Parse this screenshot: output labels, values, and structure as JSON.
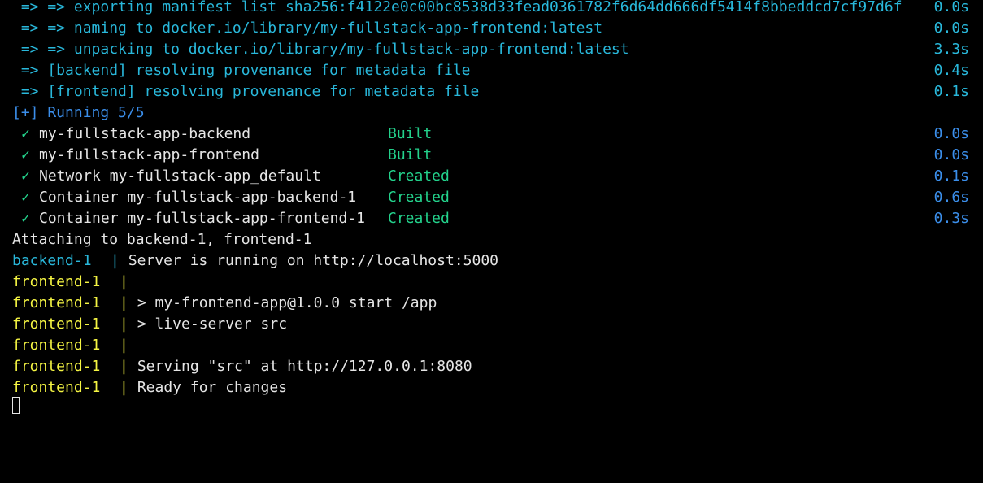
{
  "build_steps": [
    {
      "text": " => => exporting manifest list sha256:f4122e0c00bc8538d33fead0361782f6d64dd666df5414f8bbeddcd7cf97d6f",
      "duration": "0.0s"
    },
    {
      "text": " => => naming to docker.io/library/my-fullstack-app-frontend:latest",
      "duration": "0.0s"
    },
    {
      "text": " => => unpacking to docker.io/library/my-fullstack-app-frontend:latest",
      "duration": "3.3s"
    },
    {
      "text": " => [backend] resolving provenance for metadata file",
      "duration": "0.4s"
    },
    {
      "text": " => [frontend] resolving provenance for metadata file",
      "duration": "0.1s"
    }
  ],
  "running_header": "[+] Running 5/5",
  "services": [
    {
      "check": "✓",
      "name": "my-fullstack-app-backend",
      "status": "Built",
      "duration": "0.0s"
    },
    {
      "check": "✓",
      "name": "my-fullstack-app-frontend",
      "status": "Built",
      "duration": "0.0s"
    },
    {
      "check": "✓",
      "name": "Network my-fullstack-app_default",
      "status": "Created",
      "duration": "0.1s"
    },
    {
      "check": "✓",
      "name": "Container my-fullstack-app-backend-1",
      "status": "Created",
      "duration": "0.6s"
    },
    {
      "check": "✓",
      "name": "Container my-fullstack-app-frontend-1",
      "status": "Created",
      "duration": "0.3s"
    }
  ],
  "attaching_line": "Attaching to backend-1, frontend-1",
  "logs": [
    {
      "prefix": "backend-1  ",
      "pipe": "|",
      "message": " Server is running on http://localhost:5000"
    },
    {
      "prefix": "frontend-1  ",
      "pipe": "|",
      "message": ""
    },
    {
      "prefix": "frontend-1  ",
      "pipe": "|",
      "message": " > my-frontend-app@1.0.0 start /app"
    },
    {
      "prefix": "frontend-1  ",
      "pipe": "|",
      "message": " > live-server src"
    },
    {
      "prefix": "frontend-1  ",
      "pipe": "|",
      "message": ""
    },
    {
      "prefix": "frontend-1  ",
      "pipe": "|",
      "message": " Serving \"src\" at http://127.0.0.1:8080"
    },
    {
      "prefix": "frontend-1  ",
      "pipe": "|",
      "message": " Ready for changes"
    }
  ],
  "colors": {
    "background": "#000000",
    "cyan": "#29b8db",
    "blue": "#3b8eea",
    "green": "#23d18b",
    "yellow": "#f5f543",
    "text": "#e5e5e5"
  }
}
